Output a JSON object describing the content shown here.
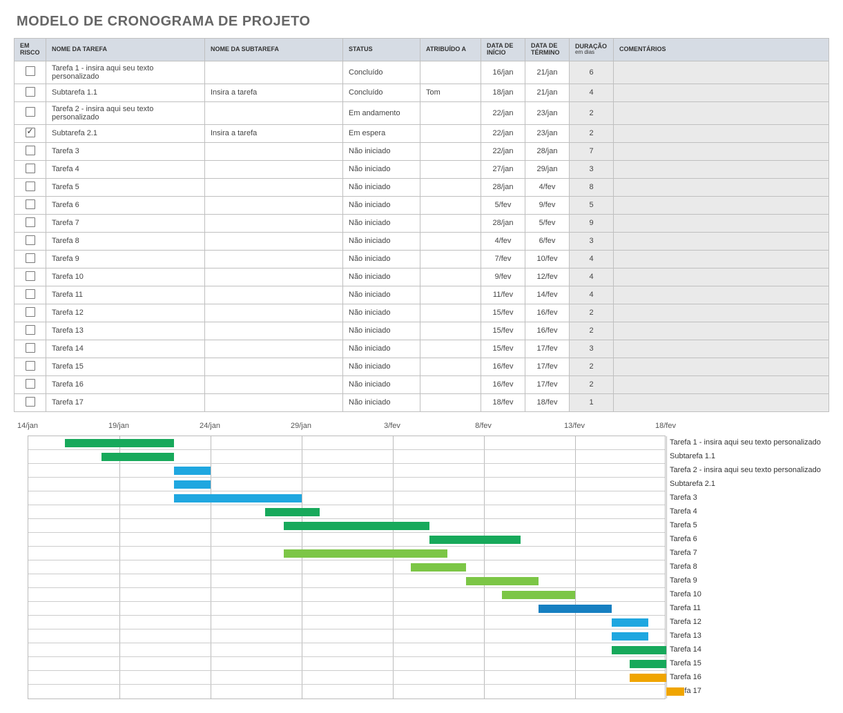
{
  "title": "MODELO DE CRONOGRAMA DE PROJETO",
  "headers": {
    "risk": "EM RISCO",
    "task": "NOME DA TAREFA",
    "subtask": "NOME DA SUBTAREFA",
    "status": "STATUS",
    "assigned": "ATRIBUÍDO A",
    "start": "DATA DE INÍCIO",
    "end": "DATA DE TÉRMINO",
    "duration": "DURAÇÃO",
    "duration_sub": "em dias",
    "comments": "COMENTÁRIOS"
  },
  "rows": [
    {
      "risk": false,
      "task": "Tarefa 1 - insira aqui seu texto personalizado",
      "subtask": "",
      "status": "Concluído",
      "assigned": "",
      "start": "16/jan",
      "end": "21/jan",
      "duration": "6",
      "comment": ""
    },
    {
      "risk": false,
      "task": "Subtarefa 1.1",
      "subtask": "Insira a tarefa",
      "status": "Concluído",
      "assigned": "Tom",
      "start": "18/jan",
      "end": "21/jan",
      "duration": "4",
      "comment": ""
    },
    {
      "risk": false,
      "task": "Tarefa 2 - insira aqui seu texto personalizado",
      "subtask": "",
      "status": "Em andamento",
      "assigned": "",
      "start": "22/jan",
      "end": "23/jan",
      "duration": "2",
      "comment": ""
    },
    {
      "risk": true,
      "task": "Subtarefa 2.1",
      "subtask": "Insira a tarefa",
      "status": "Em espera",
      "assigned": "",
      "start": "22/jan",
      "end": "23/jan",
      "duration": "2",
      "comment": ""
    },
    {
      "risk": false,
      "task": "Tarefa 3",
      "subtask": "",
      "status": "Não iniciado",
      "assigned": "",
      "start": "22/jan",
      "end": "28/jan",
      "duration": "7",
      "comment": ""
    },
    {
      "risk": false,
      "task": "Tarefa 4",
      "subtask": "",
      "status": "Não iniciado",
      "assigned": "",
      "start": "27/jan",
      "end": "29/jan",
      "duration": "3",
      "comment": ""
    },
    {
      "risk": false,
      "task": "Tarefa 5",
      "subtask": "",
      "status": "Não iniciado",
      "assigned": "",
      "start": "28/jan",
      "end": "4/fev",
      "duration": "8",
      "comment": ""
    },
    {
      "risk": false,
      "task": "Tarefa 6",
      "subtask": "",
      "status": "Não iniciado",
      "assigned": "",
      "start": "5/fev",
      "end": "9/fev",
      "duration": "5",
      "comment": ""
    },
    {
      "risk": false,
      "task": "Tarefa 7",
      "subtask": "",
      "status": "Não iniciado",
      "assigned": "",
      "start": "28/jan",
      "end": "5/fev",
      "duration": "9",
      "comment": ""
    },
    {
      "risk": false,
      "task": "Tarefa 8",
      "subtask": "",
      "status": "Não iniciado",
      "assigned": "",
      "start": "4/fev",
      "end": "6/fev",
      "duration": "3",
      "comment": ""
    },
    {
      "risk": false,
      "task": "Tarefa 9",
      "subtask": "",
      "status": "Não iniciado",
      "assigned": "",
      "start": "7/fev",
      "end": "10/fev",
      "duration": "4",
      "comment": ""
    },
    {
      "risk": false,
      "task": "Tarefa 10",
      "subtask": "",
      "status": "Não iniciado",
      "assigned": "",
      "start": "9/fev",
      "end": "12/fev",
      "duration": "4",
      "comment": ""
    },
    {
      "risk": false,
      "task": "Tarefa 11",
      "subtask": "",
      "status": "Não iniciado",
      "assigned": "",
      "start": "11/fev",
      "end": "14/fev",
      "duration": "4",
      "comment": ""
    },
    {
      "risk": false,
      "task": "Tarefa 12",
      "subtask": "",
      "status": "Não iniciado",
      "assigned": "",
      "start": "15/fev",
      "end": "16/fev",
      "duration": "2",
      "comment": ""
    },
    {
      "risk": false,
      "task": "Tarefa 13",
      "subtask": "",
      "status": "Não iniciado",
      "assigned": "",
      "start": "15/fev",
      "end": "16/fev",
      "duration": "2",
      "comment": ""
    },
    {
      "risk": false,
      "task": "Tarefa 14",
      "subtask": "",
      "status": "Não iniciado",
      "assigned": "",
      "start": "15/fev",
      "end": "17/fev",
      "duration": "3",
      "comment": ""
    },
    {
      "risk": false,
      "task": "Tarefa 15",
      "subtask": "",
      "status": "Não iniciado",
      "assigned": "",
      "start": "16/fev",
      "end": "17/fev",
      "duration": "2",
      "comment": ""
    },
    {
      "risk": false,
      "task": "Tarefa 16",
      "subtask": "",
      "status": "Não iniciado",
      "assigned": "",
      "start": "16/fev",
      "end": "17/fev",
      "duration": "2",
      "comment": ""
    },
    {
      "risk": false,
      "task": "Tarefa 17",
      "subtask": "",
      "status": "Não iniciado",
      "assigned": "",
      "start": "18/fev",
      "end": "18/fev",
      "duration": "1",
      "comment": ""
    }
  ],
  "chart_data": {
    "type": "bar",
    "title": "",
    "xlabel": "",
    "ylabel": "",
    "x_axis_ticks": [
      "14/jan",
      "19/jan",
      "24/jan",
      "29/jan",
      "3/fev",
      "8/fev",
      "13/fev",
      "18/fev"
    ],
    "x_domain_days": {
      "start_day": 14,
      "end_day": 49
    },
    "series": [
      {
        "name": "Tarefa 1 - insira aqui seu texto personalizado",
        "start_day": 16,
        "duration": 6,
        "color": "#17a95b"
      },
      {
        "name": "Subtarefa 1.1",
        "start_day": 18,
        "duration": 4,
        "color": "#17a95b"
      },
      {
        "name": "Tarefa 2 - insira aqui seu texto personalizado",
        "start_day": 22,
        "duration": 2,
        "color": "#1fa7e0"
      },
      {
        "name": "Subtarefa 2.1",
        "start_day": 22,
        "duration": 2,
        "color": "#1fa7e0"
      },
      {
        "name": "Tarefa 3",
        "start_day": 22,
        "duration": 7,
        "color": "#1fa7e0"
      },
      {
        "name": "Tarefa 4",
        "start_day": 27,
        "duration": 3,
        "color": "#17a95b"
      },
      {
        "name": "Tarefa 5",
        "start_day": 28,
        "duration": 8,
        "color": "#17a95b"
      },
      {
        "name": "Tarefa 6",
        "start_day": 36,
        "duration": 5,
        "color": "#17a95b"
      },
      {
        "name": "Tarefa 7",
        "start_day": 28,
        "duration": 9,
        "color": "#7cc646"
      },
      {
        "name": "Tarefa 8",
        "start_day": 35,
        "duration": 3,
        "color": "#7cc646"
      },
      {
        "name": "Tarefa 9",
        "start_day": 38,
        "duration": 4,
        "color": "#7cc646"
      },
      {
        "name": "Tarefa 10",
        "start_day": 40,
        "duration": 4,
        "color": "#7cc646"
      },
      {
        "name": "Tarefa 11",
        "start_day": 42,
        "duration": 4,
        "color": "#167fc1"
      },
      {
        "name": "Tarefa 12",
        "start_day": 46,
        "duration": 2,
        "color": "#1fa7e0"
      },
      {
        "name": "Tarefa 13",
        "start_day": 46,
        "duration": 2,
        "color": "#1fa7e0"
      },
      {
        "name": "Tarefa 14",
        "start_day": 46,
        "duration": 3,
        "color": "#17a95b"
      },
      {
        "name": "Tarefa 15",
        "start_day": 47,
        "duration": 2,
        "color": "#17a95b"
      },
      {
        "name": "Tarefa 16",
        "start_day": 47,
        "duration": 2,
        "color": "#f0a500"
      },
      {
        "name": "Tarefa 17",
        "start_day": 49,
        "duration": 1,
        "color": "#f0a500"
      }
    ]
  }
}
